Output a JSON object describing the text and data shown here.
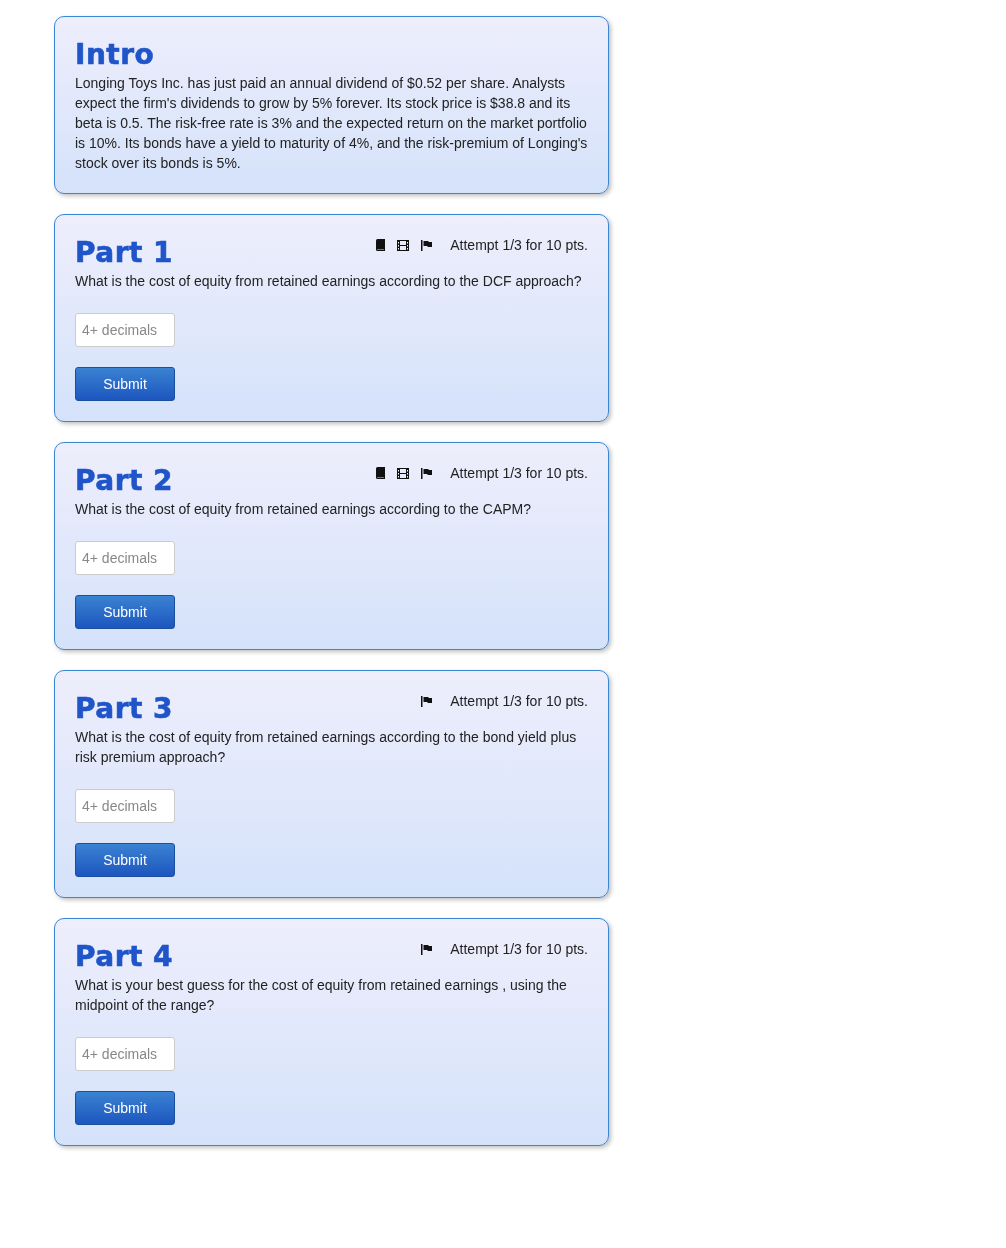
{
  "intro": {
    "title": "Intro",
    "text": "Longing Toys Inc. has just paid an annual dividend of $0.52 per share. Analysts expect the firm's dividends to grow by 5% forever. Its stock price is $38.8 and its beta is 0.5. The risk-free rate is 3% and the expected return on the market portfolio is 10%. Its bonds have a yield to maturity of 4%, and the risk-premium of Longing's stock over its bonds is 5%."
  },
  "parts": [
    {
      "title": "Part 1",
      "tools": [
        {
          "kind": "book"
        },
        {
          "kind": "video"
        },
        {
          "kind": "flag"
        }
      ],
      "attempt": "Attempt 1/3 for 10 pts.",
      "question": "What is the cost of equity from retained earnings according to the DCF approach?",
      "placeholder": "4+ decimals",
      "button": "Submit"
    },
    {
      "title": "Part 2",
      "tools": [
        {
          "kind": "book"
        },
        {
          "kind": "video"
        },
        {
          "kind": "flag"
        }
      ],
      "attempt": "Attempt 1/3 for 10 pts.",
      "question": "What is the cost of equity from retained earnings according to the CAPM?",
      "placeholder": "4+ decimals",
      "button": "Submit"
    },
    {
      "title": "Part 3",
      "tools": [
        {
          "kind": "flag"
        }
      ],
      "attempt": "Attempt 1/3 for 10 pts.",
      "question": "What is the cost of equity from retained earnings according to the bond yield plus risk premium approach?",
      "placeholder": "4+ decimals",
      "button": "Submit"
    },
    {
      "title": "Part 4",
      "tools": [
        {
          "kind": "flag"
        }
      ],
      "attempt": "Attempt 1/3 for 10 pts.",
      "question": "What is your best guess for the cost of equity from retained earnings , using the midpoint of the range?",
      "placeholder": "4+ decimals",
      "button": "Submit"
    }
  ]
}
